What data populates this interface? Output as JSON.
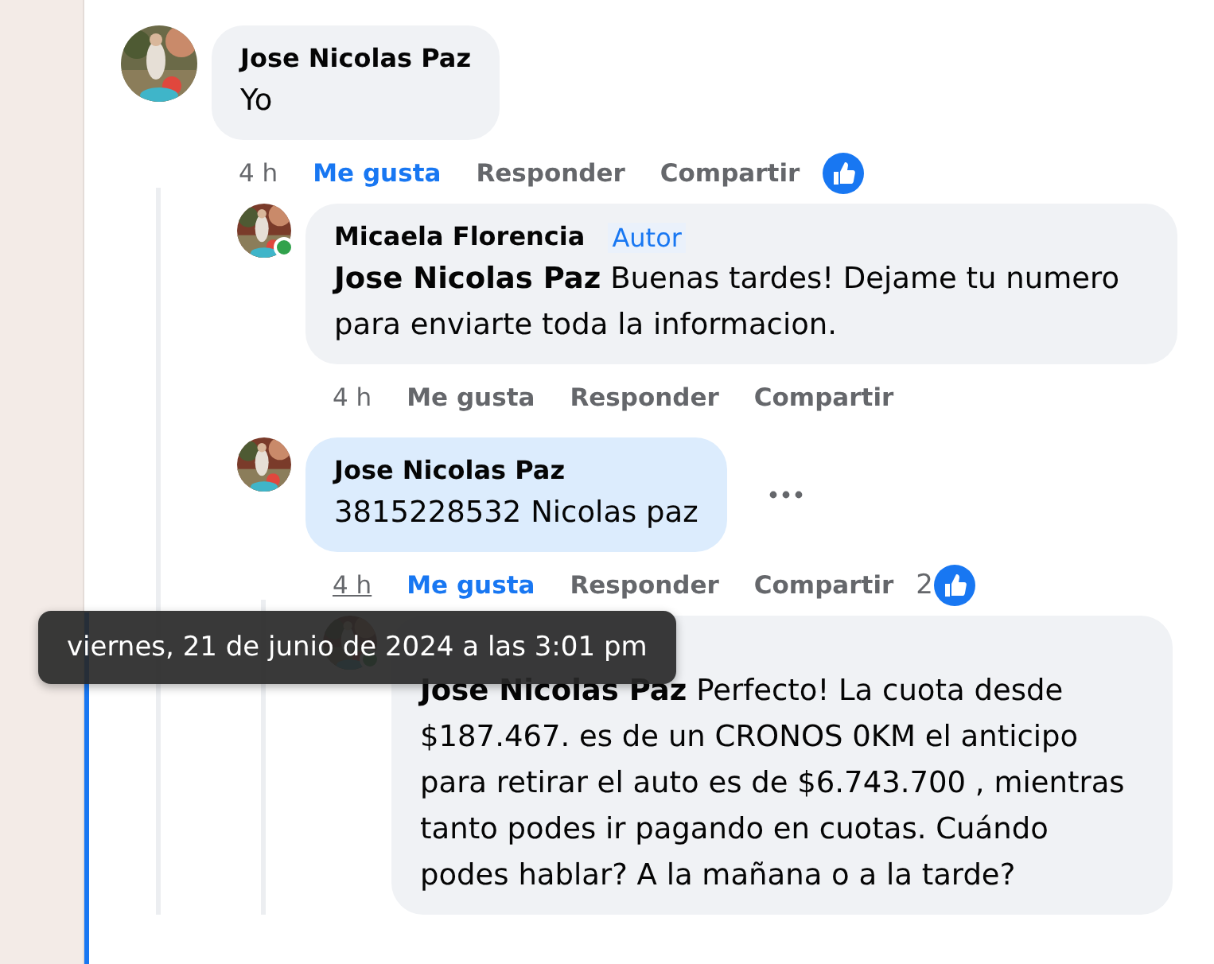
{
  "comments": [
    {
      "author": "Jose Nicolas Paz",
      "text": "Yo",
      "time": "4 h",
      "time_hovered": false,
      "liked": true,
      "actions": [
        "Me gusta",
        "Responder",
        "Compartir"
      ],
      "has_reaction": true,
      "children": [
        {
          "author": "Micaela Florencia",
          "badge": "Autor",
          "online": true,
          "mention": "Jose Nicolas Paz",
          "text": "Buenas tardes! Dejame tu numero para enviarte toda la informacion.",
          "time": "4 h",
          "time_hovered": false,
          "liked": false,
          "actions": [
            "Me gusta",
            "Responder",
            "Compartir"
          ]
        },
        {
          "author": "Jose Nicolas Paz",
          "highlighted": true,
          "text": "3815228532 Nicolas paz",
          "time": "4 h",
          "time_hovered": true,
          "liked": true,
          "actions": [
            "Me gusta",
            "Responder",
            "Compartir"
          ],
          "reaction_count": "2",
          "has_reaction": true,
          "has_menu": true,
          "children": [
            {
              "online": true,
              "mention": "Jose Nicolas Paz",
              "text": "Perfecto! La cuota desde $187.467. es de un CRONOS 0KM el anticipo para retirar el auto es de $6.743.700 , mientras tanto podes ir pagando en cuotas. Cuándo podes hablar? A la mañana o a la tarde?"
            }
          ]
        }
      ]
    }
  ],
  "tooltip": {
    "text": "viernes, 21 de junio de 2024 a las 3:01 pm"
  }
}
